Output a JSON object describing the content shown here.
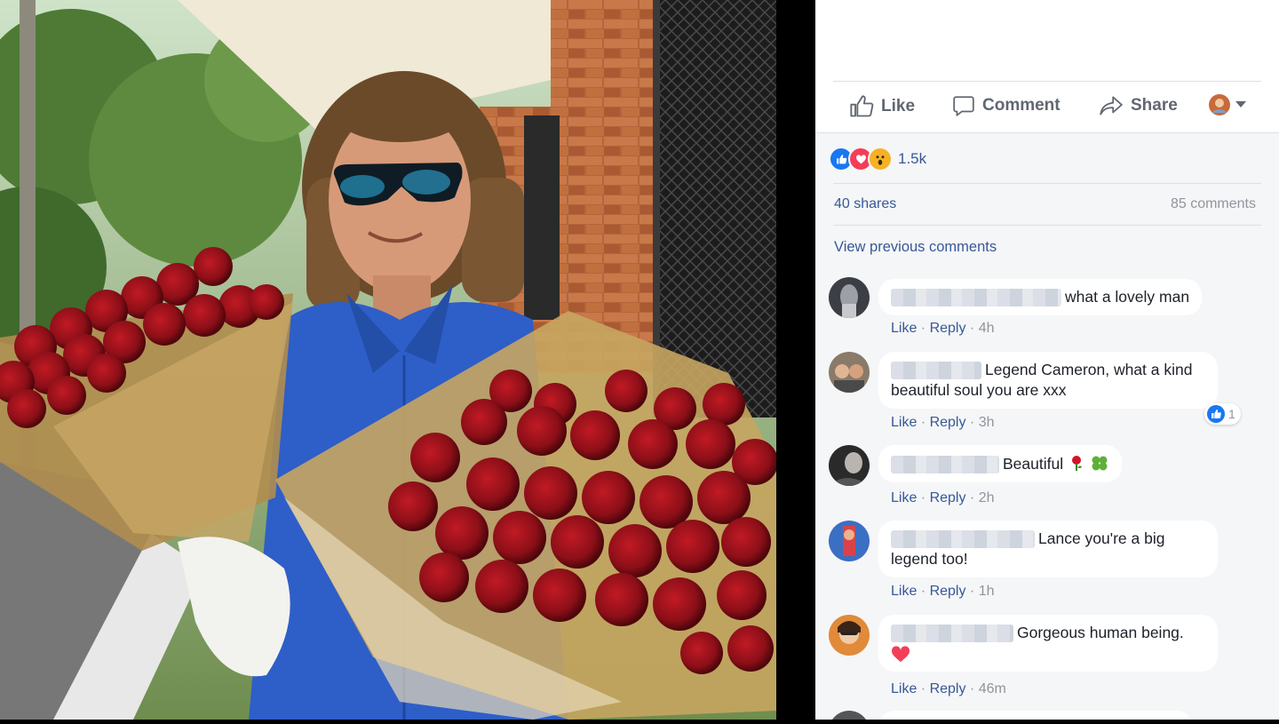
{
  "post": {
    "actions": [
      {
        "label": "Like",
        "icon": "thumbs-up-icon"
      },
      {
        "label": "Comment",
        "icon": "comment-icon"
      },
      {
        "label": "Share",
        "icon": "share-icon"
      }
    ],
    "reactions": {
      "icons": [
        "like-reaction-icon",
        "love-reaction-icon",
        "wow-reaction-icon"
      ],
      "count": "1.5k"
    },
    "shares": "40 shares",
    "comments_count": "85 comments",
    "view_previous": "View previous comments"
  },
  "comments": [
    {
      "text": "what a lovely man",
      "like": "Like",
      "reply": "Reply",
      "time": "4h"
    },
    {
      "text_line1": "Legend Cameron, what a kind",
      "text_line2": "beautiful soul you are xxx",
      "like": "Like",
      "reply": "Reply",
      "time": "3h",
      "likes": "1"
    },
    {
      "text": "Beautiful",
      "emoji": [
        "rose-emoji-icon",
        "clover-emoji-icon"
      ],
      "like": "Like",
      "reply": "Reply",
      "time": "2h"
    },
    {
      "text_line1": "Lance you're a big",
      "text_line2": "legend too!",
      "like": "Like",
      "reply": "Reply",
      "time": "1h"
    },
    {
      "text": "Gorgeous human being.",
      "emoji": [
        "heart-emoji-icon"
      ],
      "like": "Like",
      "reply": "Reply",
      "time": "46m"
    }
  ],
  "colors": {
    "link": "#385898",
    "muted": "#90949c",
    "like_blue": "#1877f2",
    "love_red": "#f33e58",
    "wow_yellow": "#f7b125"
  }
}
